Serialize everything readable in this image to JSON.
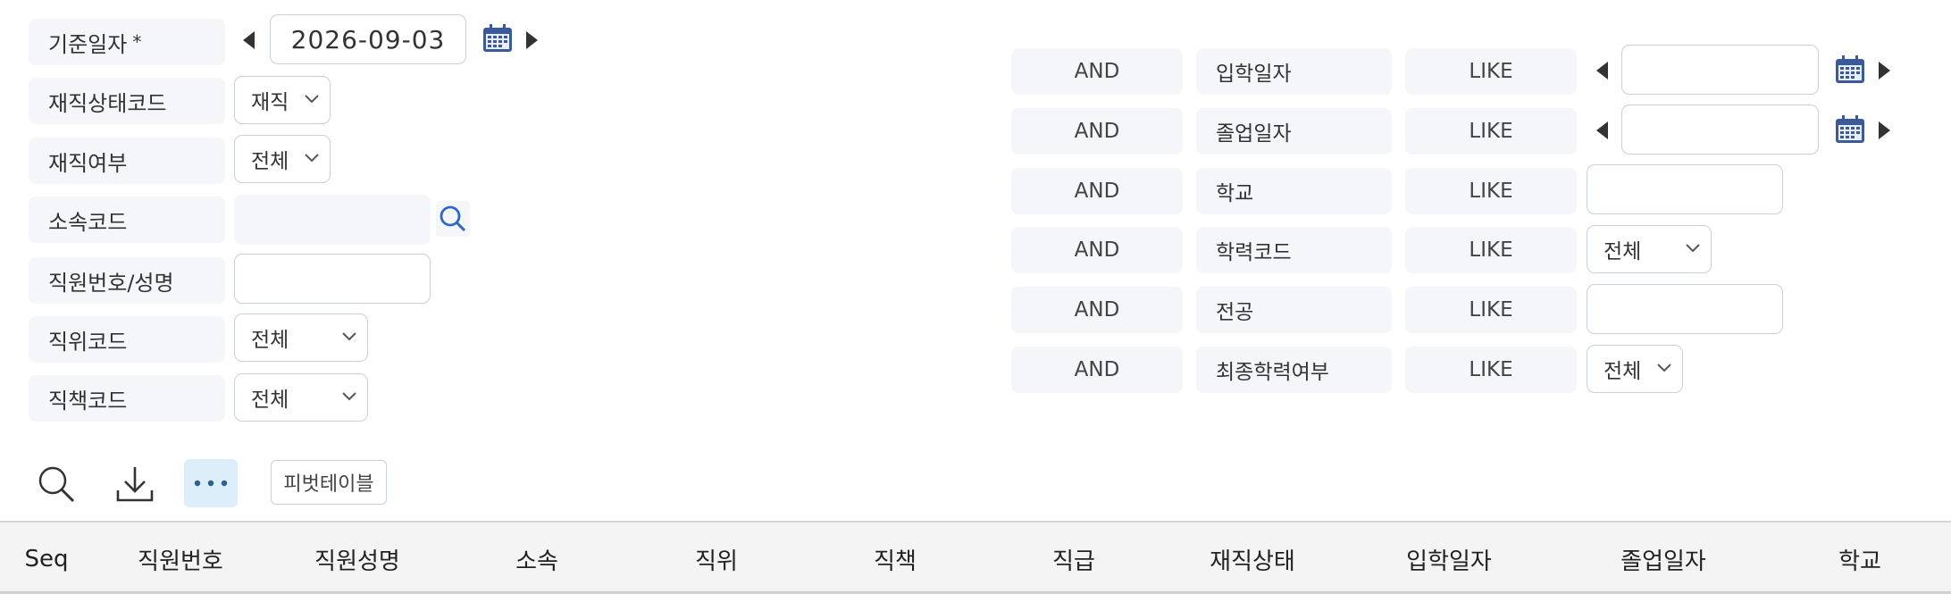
{
  "left_filters": {
    "base_date": {
      "label": "기준일자",
      "required_mark": "*",
      "value": "2026-09-03"
    },
    "emp_status_code": {
      "label": "재직상태코드",
      "selected": "재직"
    },
    "employment_yn": {
      "label": "재직여부",
      "selected": "전체"
    },
    "dept_code": {
      "label": "소속코드",
      "value": ""
    },
    "emp_no_name": {
      "label": "직원번호/성명",
      "value": ""
    },
    "position_code": {
      "label": "직위코드",
      "selected": "전체"
    },
    "duty_code": {
      "label": "직책코드",
      "selected": "전체"
    }
  },
  "right_filters": [
    {
      "op": "AND",
      "field": "입학일자",
      "cond": "LIKE",
      "type": "date",
      "value": ""
    },
    {
      "op": "AND",
      "field": "졸업일자",
      "cond": "LIKE",
      "type": "date",
      "value": ""
    },
    {
      "op": "AND",
      "field": "학교",
      "cond": "LIKE",
      "type": "text",
      "value": ""
    },
    {
      "op": "AND",
      "field": "학력코드",
      "cond": "LIKE",
      "type": "select",
      "value": "전체"
    },
    {
      "op": "AND",
      "field": "전공",
      "cond": "LIKE",
      "type": "text",
      "value": ""
    },
    {
      "op": "AND",
      "field": "최종학력여부",
      "cond": "LIKE",
      "type": "select",
      "value": "전체"
    }
  ],
  "toolbar": {
    "search_icon": "search-icon",
    "download_icon": "download-icon",
    "more_icon": "more-icon",
    "pivot_label": "피벗테이블"
  },
  "grid": {
    "columns": [
      "Seq",
      "직원번호",
      "직원성명",
      "소속",
      "직위",
      "직책",
      "직급",
      "재직상태",
      "입학일자",
      "졸업일자",
      "학교"
    ]
  },
  "colors": {
    "label_bg": "#f4f6fa",
    "border": "#c9cfdb",
    "calendar": "#3b5a9a",
    "more_bg": "#dbeefa",
    "search_icon": "#2f67c2"
  }
}
